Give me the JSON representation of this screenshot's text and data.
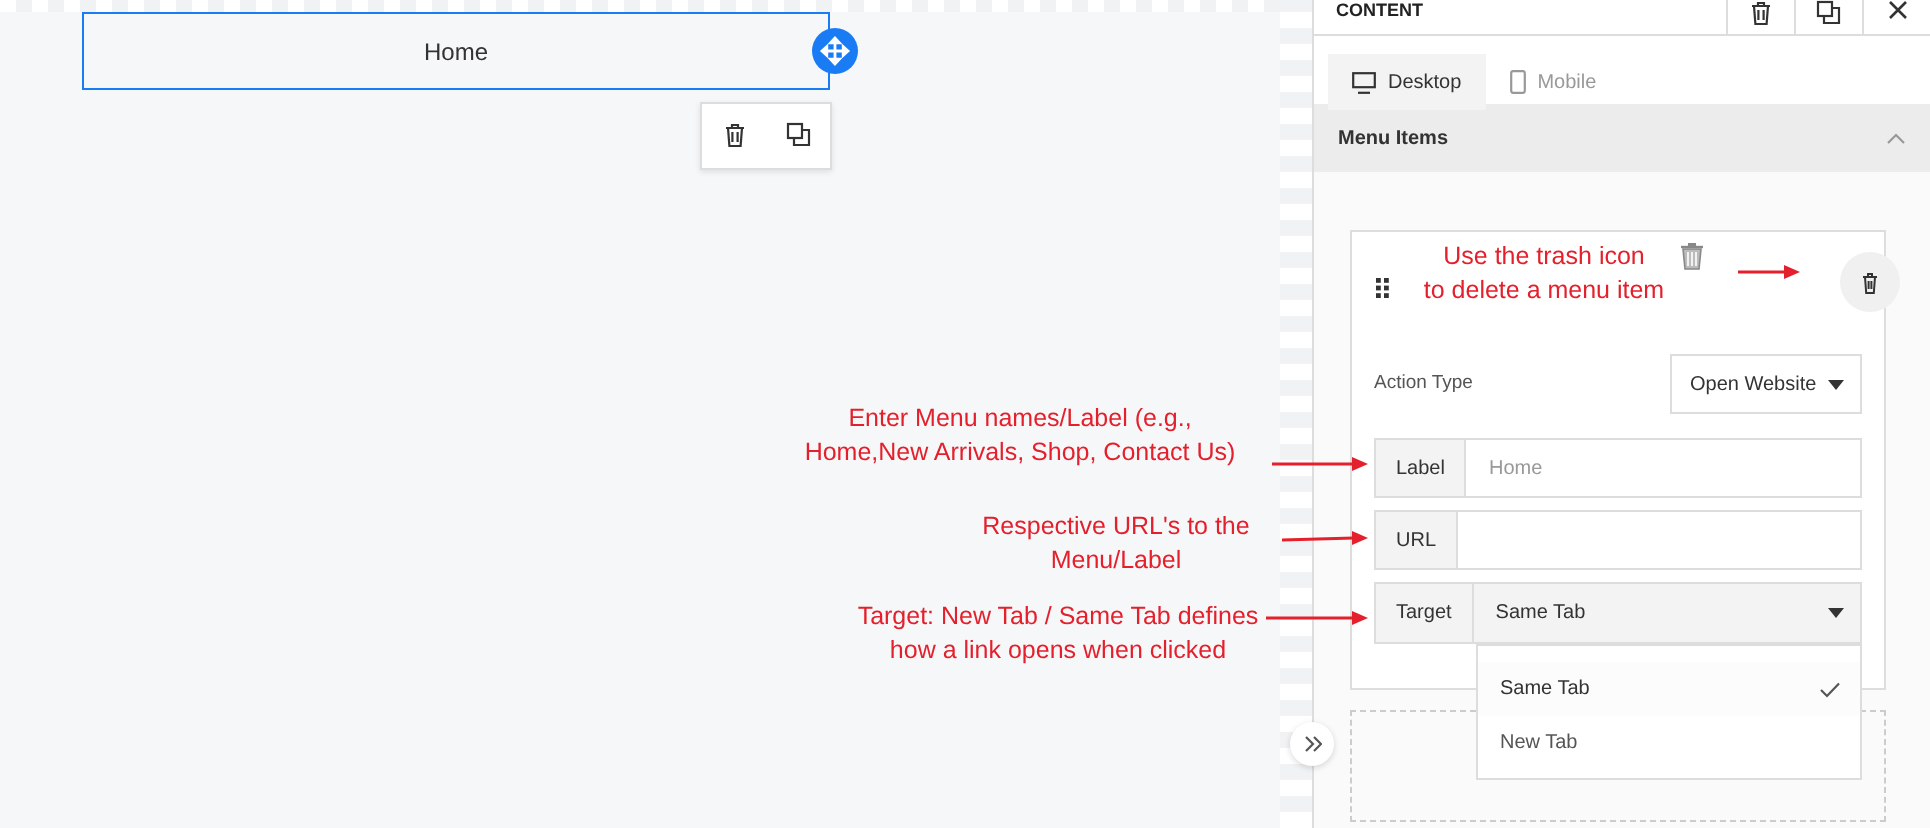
{
  "canvas": {
    "menu_preview": {
      "label": "Home"
    }
  },
  "panel": {
    "title": "CONTENT",
    "tabs": [
      {
        "label": "Desktop",
        "kind": "desktop",
        "selected": true
      },
      {
        "label": "Mobile",
        "kind": "mobile",
        "selected": false
      }
    ],
    "section": {
      "title": "Menu Items",
      "expanded": true
    },
    "menu_item": {
      "action_type": {
        "label": "Action Type",
        "value": "Open Website"
      },
      "fields": [
        {
          "kind": "text",
          "label": "Label",
          "placeholder": "Home"
        },
        {
          "kind": "text",
          "label": "URL"
        },
        {
          "kind": "select",
          "label": "Target",
          "value": "Same Tab",
          "expanded": true,
          "options": [
            {
              "label": "Same Tab",
              "selected": true
            },
            {
              "label": "New Tab",
              "selected": false
            }
          ]
        }
      ]
    }
  },
  "annotations": [
    {
      "kind": "trash",
      "text": "Use the trash icon\nto delete a menu item"
    },
    {
      "kind": "label",
      "text": "Enter Menu names/Label (e.g.,\nHome,New Arrivals, Shop, Contact Us)"
    },
    {
      "kind": "url",
      "text": "Respective URL's to the\nMenu/Label"
    },
    {
      "kind": "target",
      "text": "Target: New Tab / Same Tab defines\nhow a link opens when clicked"
    }
  ]
}
